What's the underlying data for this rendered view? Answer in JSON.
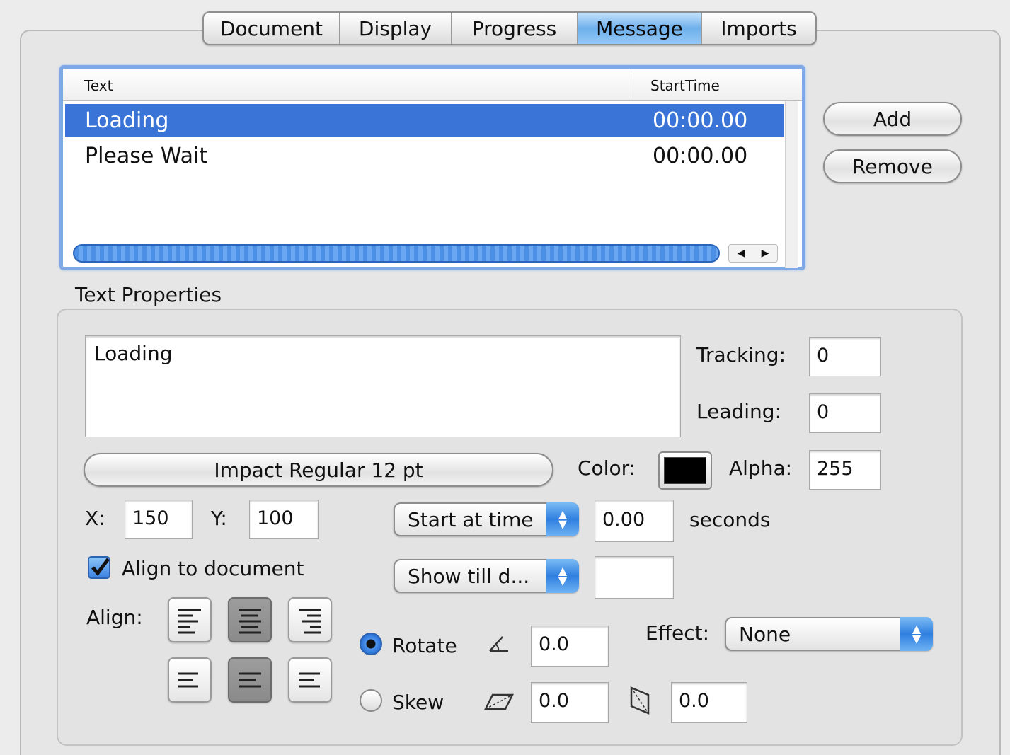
{
  "tabs": [
    "Document",
    "Display",
    "Progress",
    "Message",
    "Imports"
  ],
  "active_tab": "Message",
  "list": {
    "columns": {
      "text": "Text",
      "start_time": "StartTime"
    },
    "rows": [
      {
        "text": "Loading",
        "start_time": "00:00.00",
        "selected": true
      },
      {
        "text": "Please Wait",
        "start_time": "00:00.00",
        "selected": false
      }
    ]
  },
  "buttons": {
    "add": "Add",
    "remove": "Remove"
  },
  "text_properties": {
    "section_label": "Text Properties",
    "text_value": "Loading",
    "tracking_label": "Tracking:",
    "tracking_value": "0",
    "leading_label": "Leading:",
    "leading_value": "0",
    "font_button": "Impact Regular 12 pt",
    "color_label": "Color:",
    "color_value": "#000000",
    "alpha_label": "Alpha:",
    "alpha_value": "255",
    "x_label": "X:",
    "x_value": "150",
    "y_label": "Y:",
    "y_value": "100",
    "start_mode": "Start at time",
    "start_value": "0.00",
    "start_unit": "seconds",
    "end_mode": "Show till d...",
    "end_value": "",
    "align_to_document_label": "Align to document",
    "align_to_document_checked": true,
    "align_label": "Align:",
    "rotate_label": "Rotate",
    "rotate_value": "0.0",
    "rotate_selected": true,
    "skew_label": "Skew",
    "skew_x_value": "0.0",
    "skew_y_value": "0.0",
    "skew_selected": false,
    "effect_label": "Effect:",
    "effect_value": "None"
  }
}
